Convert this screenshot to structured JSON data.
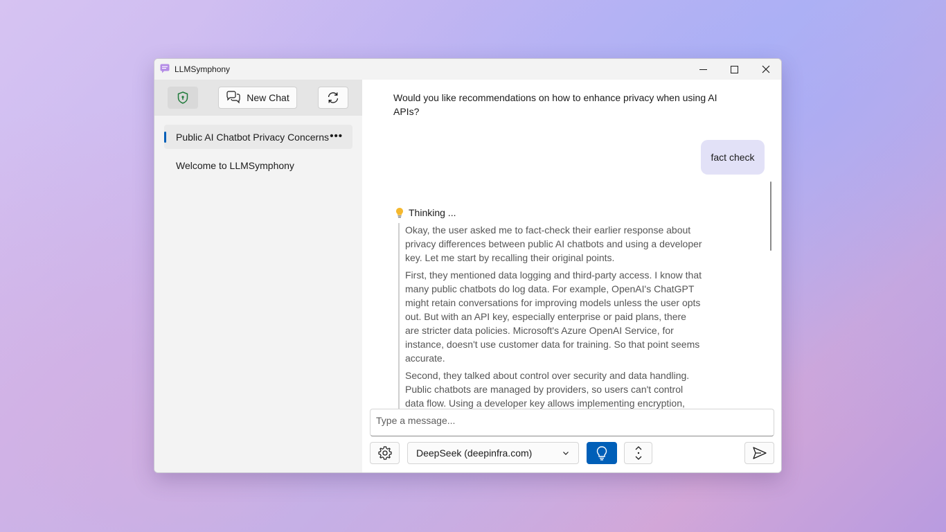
{
  "window": {
    "title": "LLMSymphony"
  },
  "sidebar": {
    "new_chat_label": "New Chat",
    "chats": [
      {
        "title": "Public AI Chatbot Privacy Concerns",
        "active": true,
        "more": "•••"
      },
      {
        "title": "Welcome to LLMSymphony",
        "active": false
      }
    ]
  },
  "conversation": {
    "assistant_text": "Would you like recommendations on how to enhance privacy when using AI APIs?",
    "user_message": "fact check",
    "thinking": {
      "label": "Thinking ...",
      "paragraphs": [
        "Okay, the user asked me to fact-check their earlier response about privacy differences between public AI chatbots and using a developer key. Let me start by recalling their original points.",
        "First, they mentioned data logging and third-party access. I know that many public chatbots do log data. For example, OpenAI's ChatGPT might retain conversations for improving models unless the user opts out. But with an API key, especially enterprise or paid plans, there are stricter data policies. Microsoft's Azure OpenAI Service, for instance, doesn't use customer data for training. So that point seems accurate.",
        "Second, they talked about control over security and data handling. Public chatbots are managed by providers, so users can't control data flow. Using a developer key allows implementing encryption, data anonymization, or private servers. This is correct because APIs give"
      ]
    }
  },
  "composer": {
    "placeholder": "Type a message...",
    "model": "DeepSeek (deepinfra.com)"
  },
  "colors": {
    "accent": "#005fb8",
    "user_bubble": "#e2e1f7"
  }
}
